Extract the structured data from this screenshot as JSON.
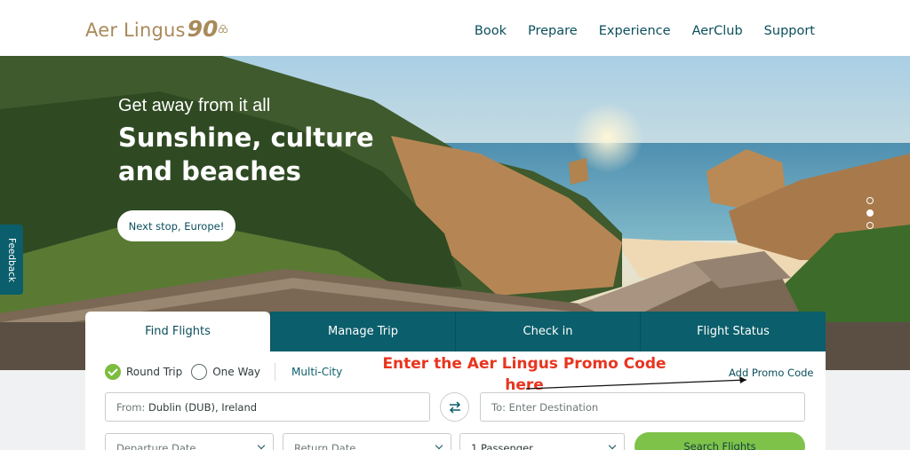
{
  "header": {
    "logo_text": "Aer Lingus",
    "logo_number": "90",
    "nav": [
      "Book",
      "Prepare",
      "Experience",
      "AerClub",
      "Support"
    ]
  },
  "hero": {
    "subtitle": "Get away from it all",
    "title": "Sunshine, culture and beaches",
    "cta": "Next stop, Europe!",
    "feedback": "Feedback"
  },
  "booking": {
    "tabs": [
      "Find Flights",
      "Manage Trip",
      "Check in",
      "Flight Status"
    ],
    "trip_types": {
      "round_trip": "Round Trip",
      "one_way": "One Way",
      "multi_city": "Multi-City"
    },
    "promo_link": "Add Promo Code",
    "from_label": "From:",
    "from_value": "Dublin (DUB), Ireland",
    "to_label": "To:",
    "to_placeholder": "Enter Destination",
    "departure_placeholder": "Departure Date",
    "return_placeholder": "Return Date",
    "passengers": "1 Passenger",
    "search_label": "Search Flights"
  },
  "annotation": {
    "text": "Enter the Aer Lingus Promo Code here",
    "color": "#e8351f"
  },
  "colors": {
    "brand_teal": "#0b5e6b",
    "brand_gold": "#a98a5a",
    "accent_green": "#7cbd3f"
  }
}
